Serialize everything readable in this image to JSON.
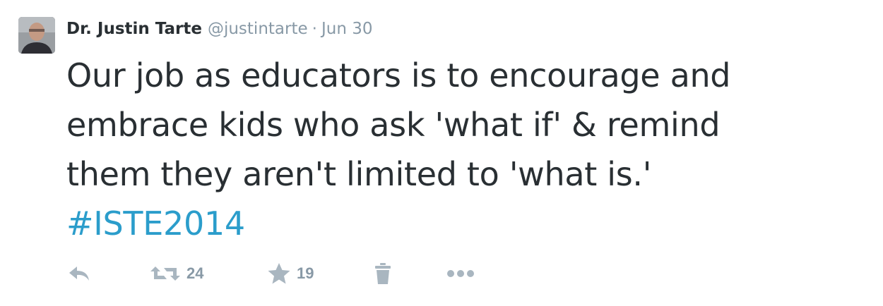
{
  "tweet": {
    "fullname": "Dr. Justin Tarte",
    "username": "@justintarte",
    "separator": "·",
    "time": "Jun 30",
    "text_lines": [
      "Our job as educators is to encourage and",
      "embrace kids who ask 'what if' & remind",
      "them they aren't limited to 'what is.'"
    ],
    "hashtag": "#ISTE2014",
    "retweet_count": "24",
    "favorite_count": "19"
  },
  "icons": {
    "avatar": "avatar-photo",
    "reply": "reply-icon",
    "retweet": "retweet-icon",
    "favorite": "star-icon",
    "delete": "trash-icon",
    "more": "more-dots-icon"
  },
  "colors": {
    "text": "#292f33",
    "muted": "#8899a6",
    "icon": "#a9b6c0",
    "hashtag": "#2b9dcb"
  }
}
